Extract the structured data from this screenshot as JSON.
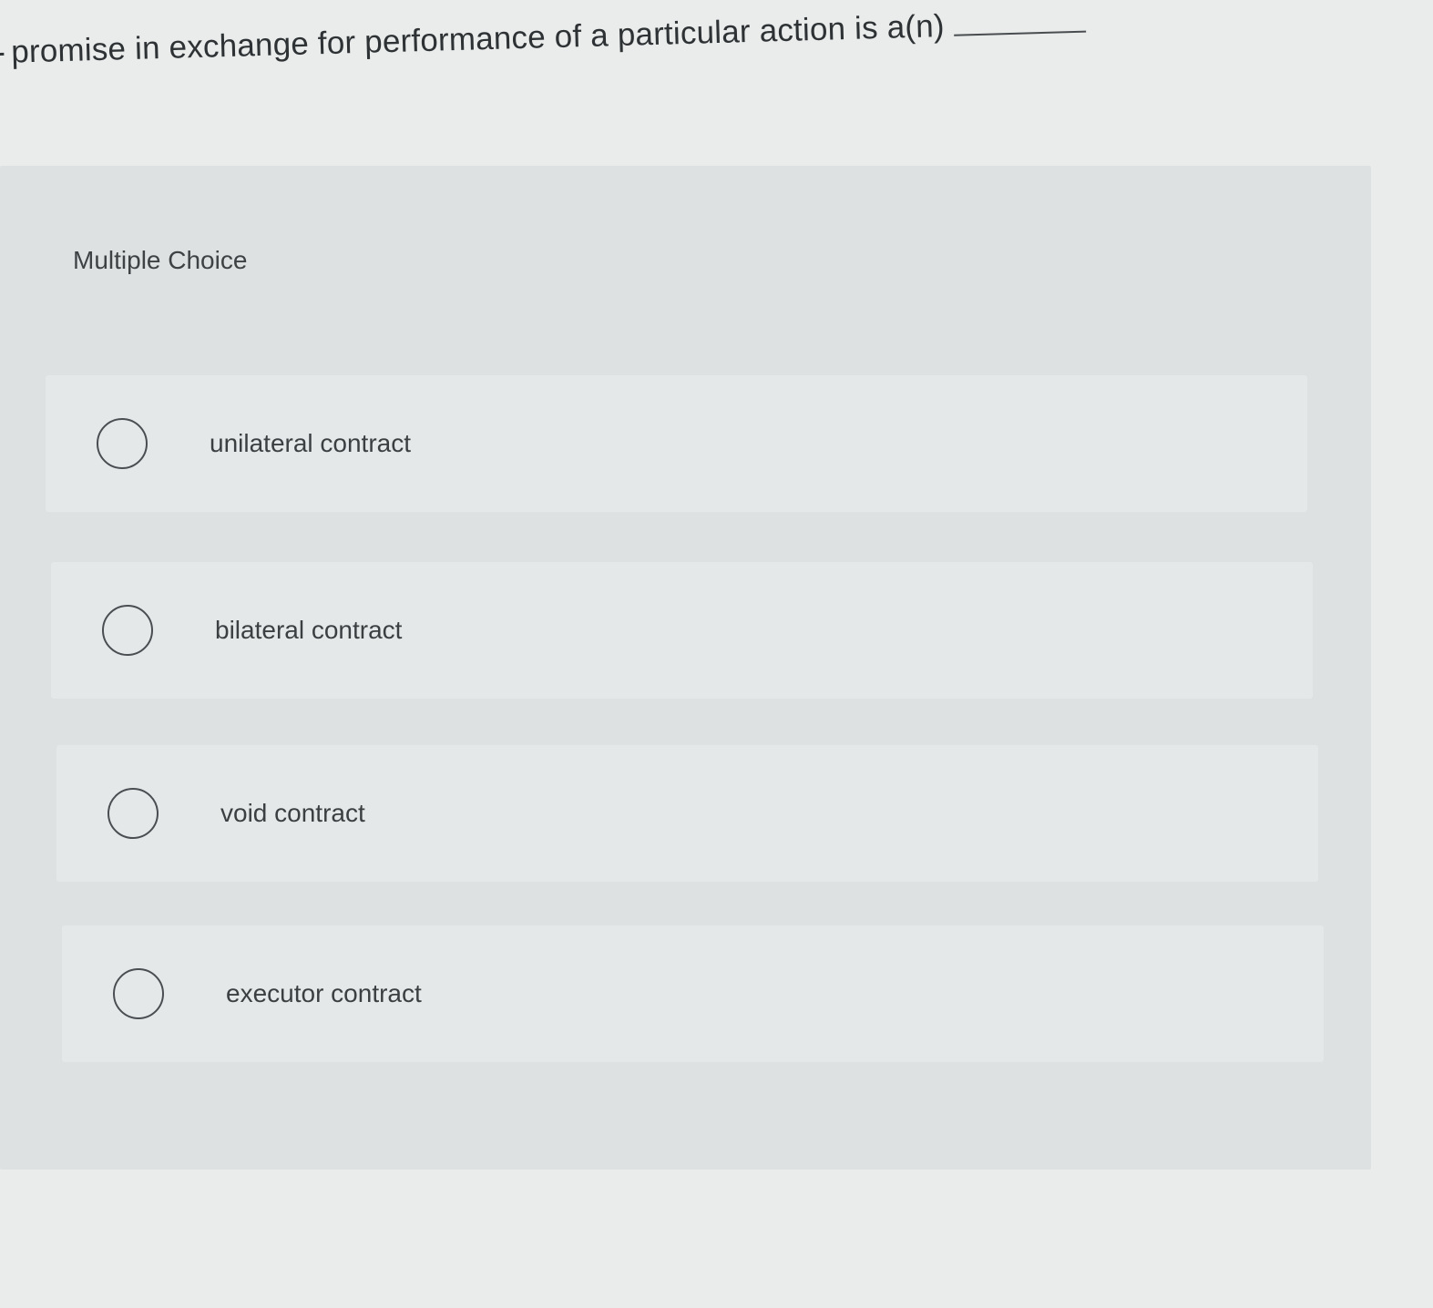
{
  "question": {
    "text": "promise in exchange for performance of a particular action is a(n)"
  },
  "section": {
    "label": "Multiple Choice"
  },
  "options": [
    {
      "label": "unilateral contract"
    },
    {
      "label": "bilateral contract"
    },
    {
      "label": "void contract"
    },
    {
      "label": "executor contract"
    }
  ],
  "icons": {
    "option_radio": "radio-circle-icon"
  }
}
